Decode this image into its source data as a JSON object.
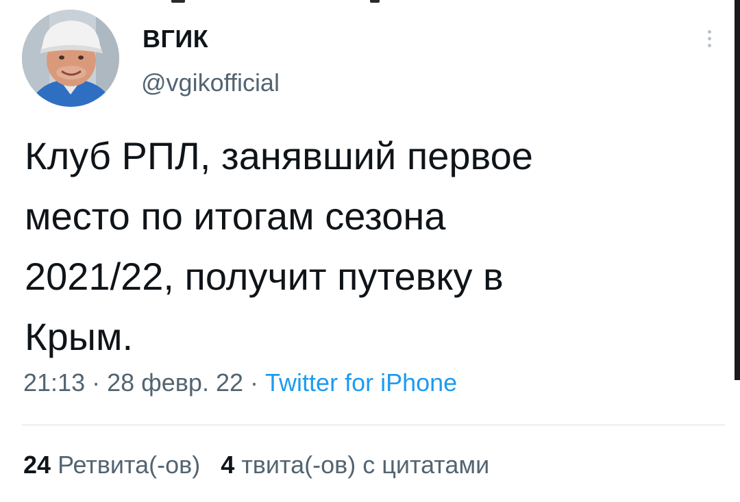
{
  "header": {
    "display_name": "ВГИК",
    "handle": "@vgikofficial"
  },
  "tweet": {
    "text": "Клуб РПЛ, занявший первое\nместо по итогам сезона\n2021/22, получит путевку в\nКрым.",
    "time": "21:13",
    "separator": "·",
    "date": "28 февр. 22",
    "source": "Twitter for iPhone"
  },
  "stats": {
    "retweets_count": "24",
    "retweets_label": "Ретвита(-ов)",
    "quotes_count": "4",
    "quotes_label": "твита(-ов) с цитатами"
  },
  "colors": {
    "text": "#0f1419",
    "secondary": "#536471",
    "accent": "#1d9bf0",
    "divider": "#d7dde2"
  },
  "icons": {
    "more": "more-vertical-icon",
    "avatar": "avatar-photo"
  }
}
